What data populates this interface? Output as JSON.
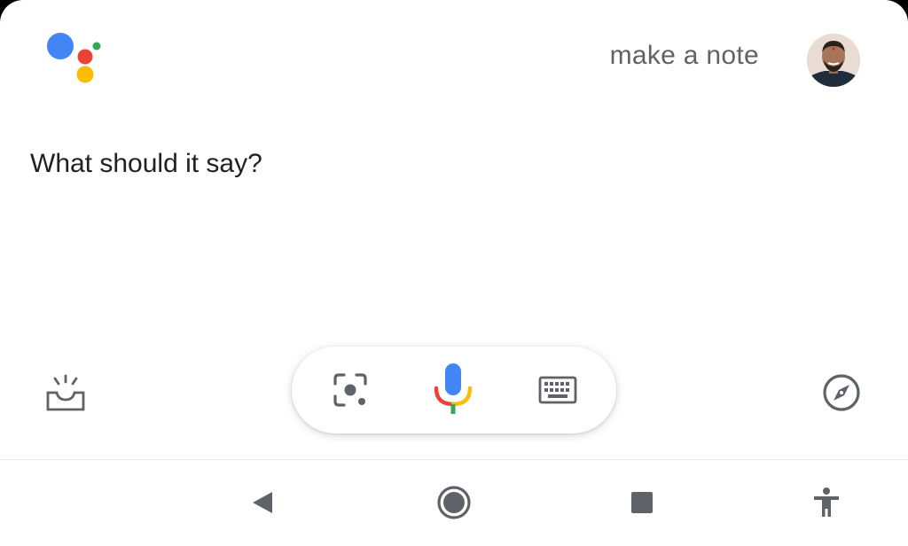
{
  "assistant": {
    "query_text": "make a note",
    "response_text": "What should it say?",
    "colors": {
      "blue": "#4285F4",
      "red": "#EA4335",
      "yellow": "#FBBC05",
      "green": "#34A853",
      "icon_gray": "#5f6368"
    }
  },
  "icons": {
    "logo": "google-assistant-logo",
    "avatar": "user-avatar",
    "updates": "snapshot-updates-icon",
    "lens": "google-lens-icon",
    "mic": "microphone-icon",
    "keyboard": "keyboard-icon",
    "explore": "explore-compass-icon"
  },
  "navigation": {
    "back": "back-triangle-icon",
    "home": "home-circle-icon",
    "recents": "recents-square-icon",
    "accessibility": "accessibility-person-icon"
  }
}
